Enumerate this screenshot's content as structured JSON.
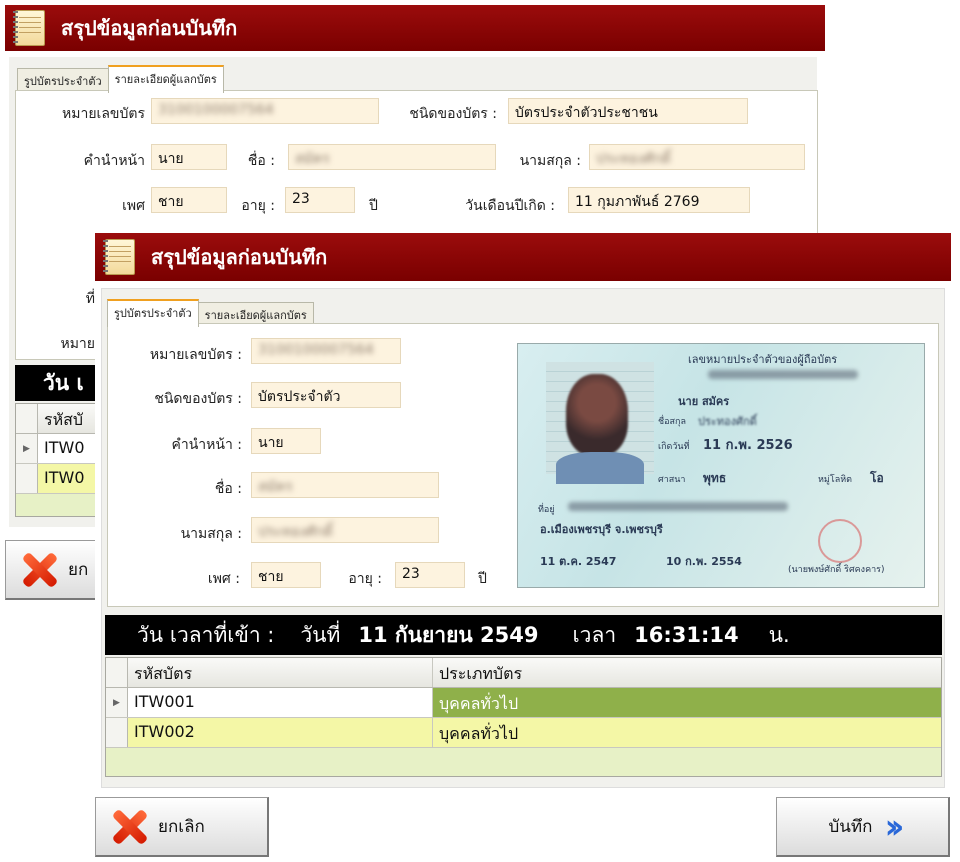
{
  "back_window": {
    "title": "สรุปข้อมูลก่อนบันทึก",
    "tabs": [
      "รูปบัตรประจำตัว",
      "รายละเอียดผู้แลกบัตร"
    ],
    "fields": {
      "card_number_label": "หมายเลขบัตร",
      "card_number_value": "3100100007564",
      "card_type_label": "ชนิดของบัตร :",
      "card_type_value": "บัตรประจำตัวประชาชน",
      "prefix_label": "คำนำหน้า",
      "prefix_value": "นาย",
      "first_name_label": "ชื่อ :",
      "first_name_value": "สมัคร",
      "last_name_label": "นามสกุล :",
      "last_name_value": "ประทองศักดิ์",
      "sex_label": "เพศ",
      "sex_value": "ชาย",
      "age_label": "อายุ :",
      "age_value": "23",
      "age_unit": "ปี",
      "birth_label": "วันเดือนปีเกิด :",
      "birth_value": "11 กุมภาพันธ์ 2769"
    },
    "partial_labels": [
      "ที่",
      "หมาย"
    ],
    "date_bar_partial": "วัน เ",
    "grid_header_partial": "รหัสบั",
    "grid_rows_partial": [
      "ITW0",
      "ITW0"
    ],
    "cancel_partial": "ยก"
  },
  "front_window": {
    "title": "สรุปข้อมูลก่อนบันทึก",
    "tabs": [
      "รูปบัตรประจำตัว",
      "รายละเอียดผู้แลกบัตร"
    ],
    "fields": {
      "card_number_label": "หมายเลขบัตร :",
      "card_number_value": "3100100007564",
      "card_type_label": "ชนิดของบัตร :",
      "card_type_value": "บัตรประจำตัว",
      "prefix_label": "คำนำหน้า :",
      "prefix_value": "นาย",
      "first_name_label": "ชื่อ :",
      "first_name_value": "สมัคร",
      "last_name_label": "นามสกุล :",
      "last_name_value": "ประทองศักดิ์",
      "sex_label": "เพศ :",
      "sex_value": "ชาย",
      "age_label": "อายุ :",
      "age_value": "23",
      "age_unit": "ปี"
    },
    "id_card": {
      "header": "เลขหมายประจำตัวของผู้ถือบัตร",
      "name": "นาย สมัคร",
      "surname_label": "ชื่อสกุล",
      "surname": "ประทองศักดิ์",
      "birth_label": "เกิดวันที่",
      "birth": "11 ก.พ. 2526",
      "religion_label": "ศาสนา",
      "religion": "พุทธ",
      "blood_label": "หมู่โลหิต",
      "blood": "โอ",
      "address_label": "ที่อยู่",
      "district": "อ.เมืองเพชรบุรี จ.เพชรบุรี",
      "issue_date": "11 ต.ค. 2547",
      "expiry_date": "10 ก.พ. 2554",
      "issuer": "(นายพงษ์ศักดิ์ ริศคงคาร)"
    },
    "date_bar": {
      "label": "วัน เวลาที่เข้า :",
      "date_label": "วันที่",
      "date_value": "11 กันยายน 2549",
      "time_label": "เวลา",
      "time_value": "16:31:14",
      "unit": "น."
    },
    "grid": {
      "columns": [
        "รหัสบัตร",
        "ประเภทบัตร"
      ],
      "rows": [
        {
          "code": "ITW001",
          "type": "บุคคลทั่วไป"
        },
        {
          "code": "ITW002",
          "type": "บุคคลทั่วไป"
        }
      ]
    },
    "buttons": {
      "cancel": "ยกเลิก",
      "save": "บันทึก"
    }
  }
}
